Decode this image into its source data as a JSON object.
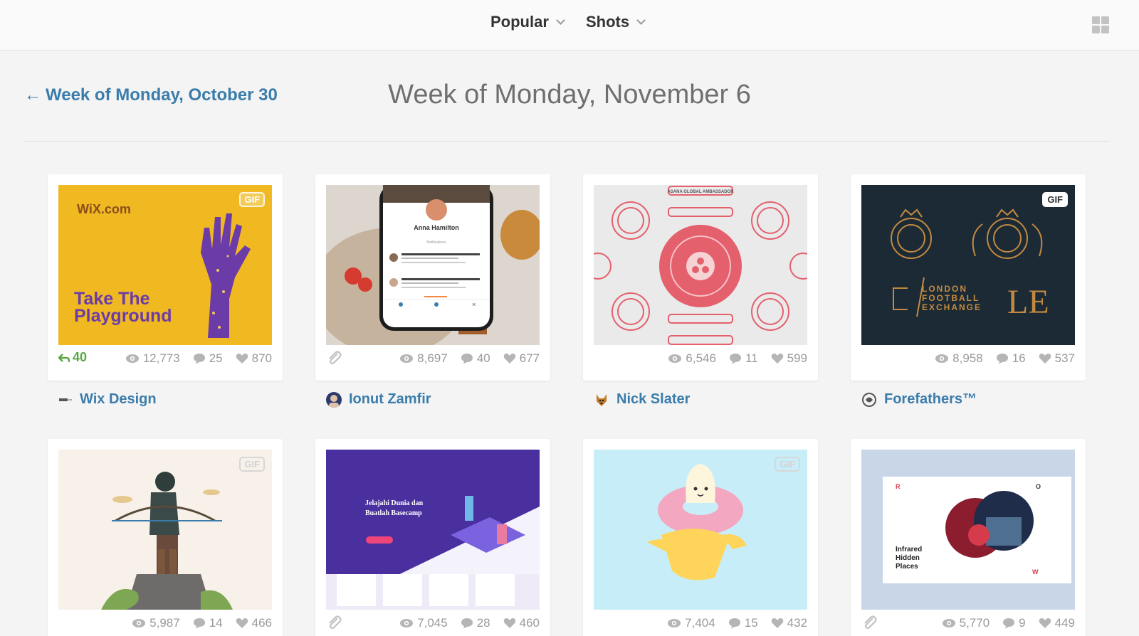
{
  "nav": {
    "menu1": "Popular",
    "menu2": "Shots"
  },
  "week": {
    "prev_arrow": "←",
    "prev_label": "Week of Monday, October 30",
    "title": "Week of Monday, November 6"
  },
  "shots": [
    {
      "views": "12,773",
      "comments": "25",
      "likes": "870",
      "rebounds": "40",
      "gif": "GIF",
      "author": "Wix Design",
      "thumb_text": "Take The Playground",
      "brand": "WiX.com"
    },
    {
      "views": "8,697",
      "comments": "40",
      "likes": "677",
      "author": "Ionut Zamfir",
      "thumb_text": "Anna Hamilton"
    },
    {
      "views": "6,546",
      "comments": "11",
      "likes": "599",
      "author": "Nick Slater",
      "thumb_text": "ASANA GLOBAL AMBASSADOR"
    },
    {
      "views": "8,958",
      "comments": "16",
      "likes": "537",
      "gif": "GIF",
      "author": "Forefathers™",
      "thumb_text": "LONDON FOOTBALL EXCHANGE"
    },
    {
      "views": "5,987",
      "comments": "14",
      "likes": "466",
      "gif": "GIF"
    },
    {
      "views": "7,045",
      "comments": "28",
      "likes": "460",
      "thumb_text": "Jelajahi Dunia dan Buatlah Basecamp"
    },
    {
      "views": "7,404",
      "comments": "15",
      "likes": "432",
      "gif": "GIF"
    },
    {
      "views": "5,770",
      "comments": "9",
      "likes": "449",
      "thumb_text": "Infrared Hidden Places"
    }
  ],
  "colors": {
    "link": "#3a7cab",
    "rebound": "#5aa844",
    "muted": "#9a9a9a"
  },
  "icons": [
    "chevron-down-icon",
    "grid-view-icon",
    "eye-icon",
    "comment-icon",
    "heart-icon",
    "rebound-icon",
    "attachment-icon"
  ]
}
